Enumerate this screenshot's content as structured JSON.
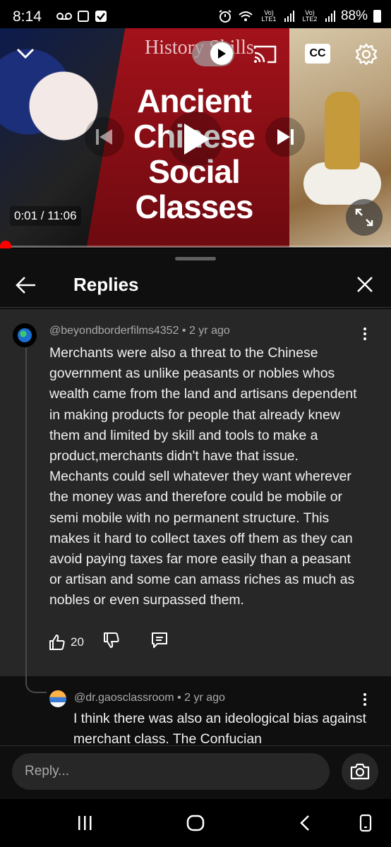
{
  "status_bar": {
    "time": "8:14",
    "signal_1": "Vo) LTE1",
    "signal_2": "Vo) LTE2",
    "battery": "88%"
  },
  "video": {
    "brand_text": "History Skills",
    "title_text": "Ancient Chinese Social Classes",
    "cc_label": "CC",
    "current_time": "0:01",
    "duration": "11:06",
    "time_display": "0:01 / 11:06",
    "progress_fraction": 0.0015
  },
  "panel": {
    "title": "Replies"
  },
  "comments": [
    {
      "meta": "@beyondborderfilms4352 • 2 yr ago",
      "text": "Merchants were also a threat to the Chinese government as unlike peasants or nobles whos wealth came from the land and artisans dependent in making products for people that already knew them and limited by skill and tools to make a product,merchants didn't have that issue. Mechants could sell whatever they want wherever the money was and therefore could be mobile or semi mobile with no permanent structure. This makes it hard to collect taxes off them as they can avoid paying taxes far more easily than a peasant or artisan and some can amass riches as much as nobles or even surpassed them.",
      "likes": "20"
    },
    {
      "meta": "@dr.gaosclassroom • 2 yr ago",
      "text": "I think there was also an ideological bias against merchant class. The Confucian"
    }
  ],
  "reply_bar": {
    "placeholder": "Reply..."
  },
  "colors": {
    "accent_red": "#ff0000",
    "panel_bg": "#0f0f0f",
    "highlight_bg": "#272727"
  }
}
